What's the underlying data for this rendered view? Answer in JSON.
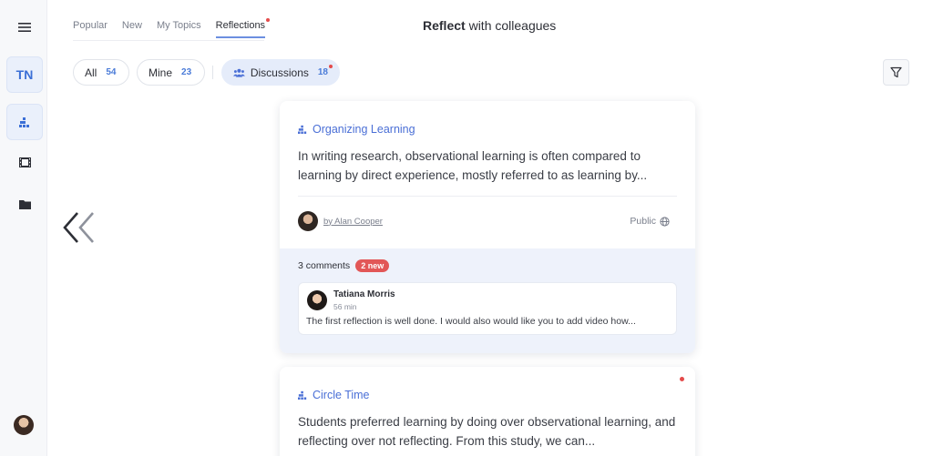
{
  "sidebar": {
    "user_initials": "TN"
  },
  "tabs": [
    {
      "label": "Popular"
    },
    {
      "label": "New"
    },
    {
      "label": "My Topics"
    },
    {
      "label": "Reflections"
    }
  ],
  "header": {
    "title_bold": "Reflect",
    "title_rest": " with colleagues"
  },
  "filters": {
    "all": {
      "label": "All",
      "count": "54"
    },
    "mine": {
      "label": "Mine",
      "count": "23"
    },
    "discussions": {
      "label": "Discussions",
      "count": "18"
    }
  },
  "cards": [
    {
      "topic": "Organizing Learning",
      "text": "In writing research, observational learning is often compared to learning by direct experience, mostly referred to as learning by...",
      "author": "by Alan Cooper",
      "visibility": "Public",
      "comments_count": "3 comments",
      "new_badge": "2 new",
      "comment": {
        "name": "Tatiana Morris",
        "time": "56 min",
        "text": "The first reflection is well done. I would also would like you to add video how..."
      }
    },
    {
      "topic": "Circle Time",
      "text": "Students preferred learning by doing over observational learning, and reflecting over not reflecting. From this study, we can..."
    }
  ],
  "colors": {
    "accent": "#4a6fd6",
    "notification": "#e44b4b",
    "badge": "#e25757"
  }
}
